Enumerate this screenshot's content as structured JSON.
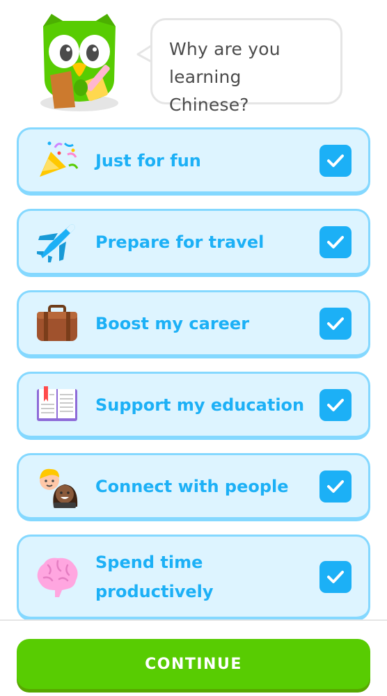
{
  "prompt": {
    "line1": "Why are you",
    "line2": "learning Chinese?"
  },
  "options": [
    {
      "label": "Just for fun",
      "icon": "party-popper-icon",
      "checked": true
    },
    {
      "label": "Prepare for travel",
      "icon": "airplane-icon",
      "checked": true
    },
    {
      "label": "Boost my career",
      "icon": "briefcase-icon",
      "checked": true
    },
    {
      "label": "Support my education",
      "icon": "open-book-icon",
      "checked": true
    },
    {
      "label": "Connect with people",
      "icon": "people-icon",
      "checked": true
    },
    {
      "label": "Spend time productively",
      "label_line1": "Spend time",
      "label_line2": "productively",
      "icon": "brain-icon",
      "checked": true
    }
  ],
  "footer": {
    "continue_label": "CONTINUE"
  },
  "colors": {
    "accent_blue": "#1cb0f6",
    "option_bg": "#ddf4ff",
    "option_border": "#84d8ff",
    "continue_green": "#58cc02"
  }
}
